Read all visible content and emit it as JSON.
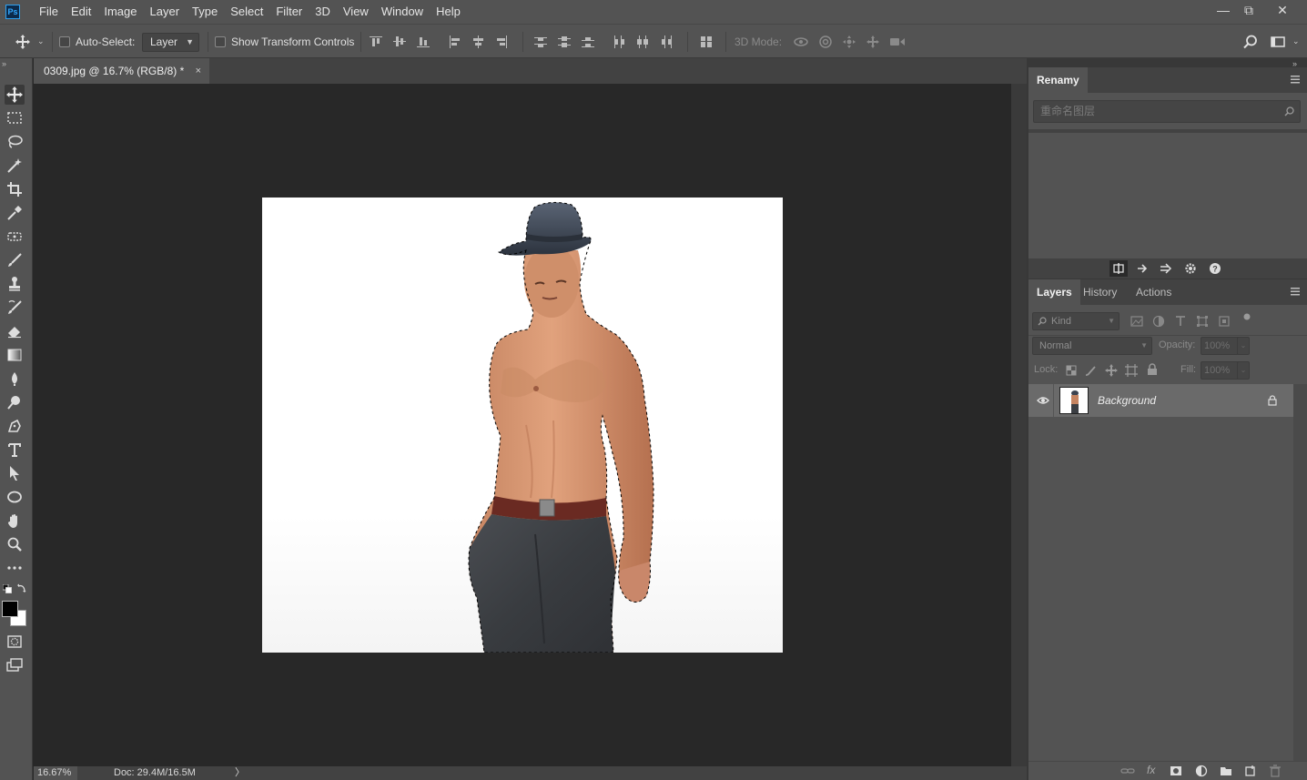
{
  "app": {
    "logo": "Ps"
  },
  "menu": [
    "File",
    "Edit",
    "Image",
    "Layer",
    "Type",
    "Select",
    "Filter",
    "3D",
    "View",
    "Window",
    "Help"
  ],
  "window_controls": {
    "minimize": "—",
    "restore": "⧉",
    "close": "✕"
  },
  "options": {
    "auto_select_label": "Auto-Select:",
    "auto_select_target": "Layer",
    "show_transform_label": "Show Transform Controls",
    "mode_3d_label": "3D Mode:"
  },
  "document": {
    "tab_title": "0309.jpg @ 16.7% (RGB/8) *",
    "close_glyph": "×",
    "zoom": "16.67%",
    "doc_info": "Doc: 29.4M/16.5M",
    "status_arrow": "〉"
  },
  "renamy_panel": {
    "title": "Renamy",
    "search_placeholder": "重命名图层"
  },
  "layers_panel": {
    "tabs": [
      "Layers",
      "History",
      "Actions"
    ],
    "active_tab": "Layers",
    "filter_kind": "Kind",
    "blend_mode": "Normal",
    "opacity_label": "Opacity:",
    "opacity_value": "100%",
    "lock_label": "Lock:",
    "fill_label": "Fill:",
    "fill_value": "100%",
    "layers": [
      {
        "name": "Background",
        "visible": true,
        "locked": true
      }
    ]
  },
  "colors": {
    "chrome": "#535353",
    "workspace": "#282828",
    "panel_bg": "#424242",
    "foreground_color": "#000000",
    "background_color": "#ffffff"
  }
}
